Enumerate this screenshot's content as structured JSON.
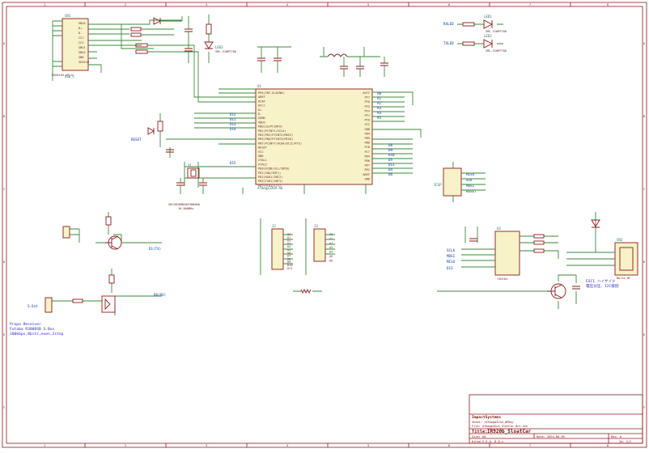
{
  "title_block": {
    "company": "ImpactSystems",
    "sheet": "Sheet: /ATmega32u4_8PNu/",
    "file": "File: ATmega32u4_SlotCar-Ant.sch",
    "title_prefix": "Title:",
    "title": "IR920b_SloatCar",
    "size": "Size: A4",
    "date": "Date: 2024-08-30",
    "rev_label": "Rev: b",
    "kicad": "KiCad E.D.A. 8.0.x",
    "id": "Id: 2/2"
  },
  "frame": {
    "cols": [
      "1",
      "2",
      "3",
      "4",
      "5",
      "6",
      "7",
      "8"
    ],
    "rows": [
      "A",
      "B",
      "C",
      "D",
      "E",
      "F"
    ]
  },
  "usb": {
    "ref": "CN1",
    "name": "USB_C",
    "part": "USB4105-GF-A",
    "pins": [
      "VBUS",
      "D+",
      "D-",
      "CC1",
      "CC2",
      "SBU1",
      "SBU2",
      "GND",
      "SHIELD"
    ]
  },
  "mcu": {
    "ref": "U1",
    "name": "ATmega32U4-AU",
    "left_pins": [
      "PE6(INT.6/AIN0)",
      "AREF",
      "UCAP",
      "UVcc",
      "D+",
      "D-",
      "UGND",
      "VBUS",
      "PB0(SS/PCINT0)",
      "PB1(PCINT1/SCLK)",
      "PB2(PDI/PCINT2/MOSI)",
      "PB3(PDO/PCINT3/MISO)",
      "PB7(PCINT7/OC0A/OC1C/RTS)",
      "RESET",
      "VCC",
      "GND",
      "XTAL1",
      "XTAL2",
      "PD0(OC0B/SCL/INT0)",
      "PD1(SDA/INT1)",
      "PD2(RXD1/INT2)",
      "PD3(TXD1/INT3)",
      "PD5(XCK1/CTS)"
    ],
    "right_pins": [
      "AVCC",
      "PF7",
      "PF6",
      "PF5",
      "PF4",
      "PF1",
      "PF0",
      "VCC",
      "GND",
      "PB4",
      "PB5",
      "PB6",
      "PC6",
      "PC7",
      "PD4",
      "PD6",
      "PD7",
      "PE2",
      "AREF",
      "GND"
    ],
    "nets_left": [
      "D12",
      "D11",
      "D13",
      "D14",
      "D15"
    ],
    "nets_right": [
      "A0",
      "A1",
      "A2",
      "A3",
      "A4",
      "A5",
      "D8",
      "D9",
      "D10",
      "D5",
      "D13",
      "D4",
      "D6"
    ]
  },
  "crystal": {
    "ref": "Y1",
    "value": "16.000MHz",
    "part": "XRCGB16M000F3M00R0"
  },
  "leds": [
    {
      "ref": "LED1",
      "label": "RX LED",
      "value": "SML-310MTT86"
    },
    {
      "ref": "LED2",
      "label": "TX LED",
      "value": "SML-310MTT86"
    },
    {
      "ref": "LED3",
      "label": "PWR",
      "value": "SML-310MTT86"
    }
  ],
  "nets": {
    "rxled": "RXLED",
    "txled": "TXLED",
    "reset": "RESET",
    "vcc": "VCC5V",
    "gnd": "GND",
    "icsp": "ICSP",
    "d1": "D1(TX)",
    "d0": "D0(RX)",
    "sout": "S.Out"
  },
  "headers": [
    {
      "ref": "J2",
      "pins": [
        "D0",
        "D1",
        "D2",
        "D3",
        "D4",
        "D5",
        "D6",
        "D7",
        "D8",
        "D9",
        "D10",
        "D11"
      ]
    },
    {
      "ref": "J3",
      "pins": [
        "A0",
        "A1",
        "A2",
        "A3",
        "A4",
        "A5",
        "A6"
      ]
    }
  ],
  "icsp_labels": [
    "MISO",
    "SCK",
    "MOSI",
    "RESET"
  ],
  "note_left": "Propo Receiver\nFutaba R3008SB S.Bus\n100kbps,8bits,even,2stop",
  "note_right": "ESC1 ハイサイド\n電圧分圧、I2C接続",
  "right_connector": {
    "ref": "CN2",
    "name": "Molex_BF"
  },
  "driver": {
    "ref": "U3",
    "name": "74HC04",
    "pins": [
      "SCLK",
      "MOSI",
      "MISO",
      "D13"
    ]
  }
}
